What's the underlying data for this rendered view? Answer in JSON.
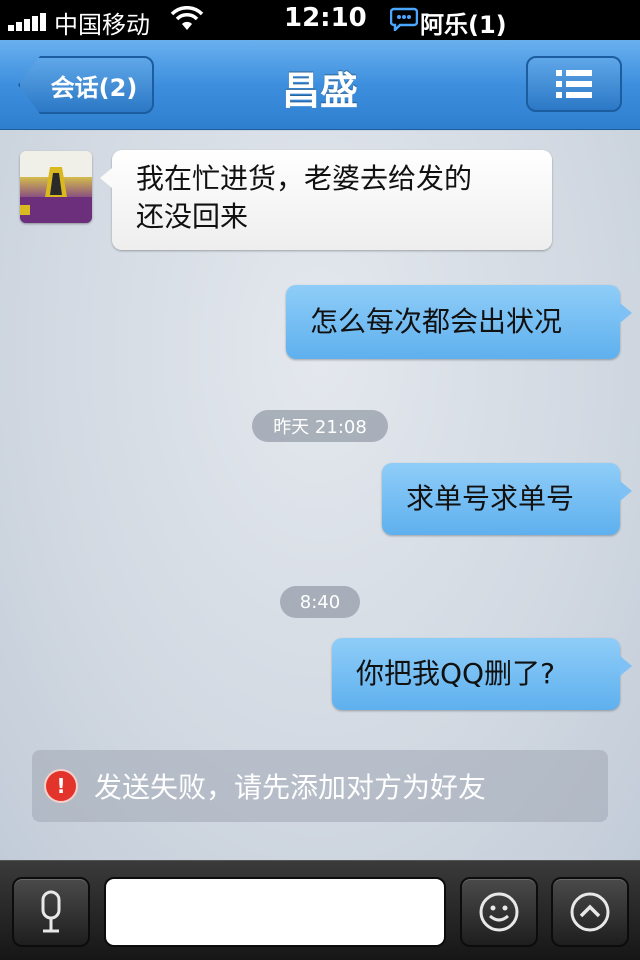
{
  "status_bar": {
    "carrier": "中国移动",
    "time": "12:10",
    "notification": "阿乐(1)"
  },
  "nav": {
    "back_label": "会话(2)",
    "title": "昌盛"
  },
  "messages": [
    {
      "text_line1": "我在忙进货，老婆去给发的",
      "text_line2": "还没回来"
    },
    {
      "text": "怎么每次都会出状况"
    },
    {
      "timestamp": "昨天 21:08"
    },
    {
      "text": "求单号求单号"
    },
    {
      "timestamp": "8:40"
    },
    {
      "text": "你把我QQ删了?"
    }
  ],
  "error": {
    "icon": "!",
    "text": "发送失败，请先添加对方为好友"
  },
  "input": {
    "value": "",
    "placeholder": ""
  },
  "colors": {
    "nav_blue": "#3d8fde",
    "bubble_out": "#5eb0ee",
    "error_red": "#e2342a"
  }
}
